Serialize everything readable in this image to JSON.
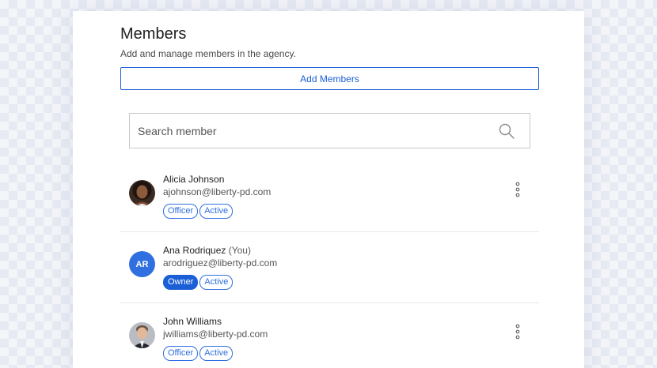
{
  "header": {
    "title": "Members",
    "subtitle": "Add and manage members in the agency.",
    "add_button": "Add Members"
  },
  "search": {
    "placeholder": "Search member",
    "icon": "search-icon"
  },
  "members": [
    {
      "name": "Alicia Johnson",
      "suffix": "",
      "email": "ajohnson@liberty-pd.com",
      "avatar": "photo",
      "role": "Officer",
      "status": "Active",
      "has_menu": true
    },
    {
      "name": "Ana Rodriquez",
      "suffix": "(You)",
      "email": "arodriguez@liberty-pd.com",
      "avatar_initials": "AR",
      "role": "Owner",
      "status": "Active",
      "has_menu": false
    },
    {
      "name": "John Williams",
      "suffix": "",
      "email": "jwilliams@liberty-pd.com",
      "avatar": "photo",
      "role": "Officer",
      "status": "Active",
      "has_menu": true
    }
  ],
  "colors": {
    "accent": "#1b5fd6",
    "avatar_bg": "#2f6fe0"
  }
}
